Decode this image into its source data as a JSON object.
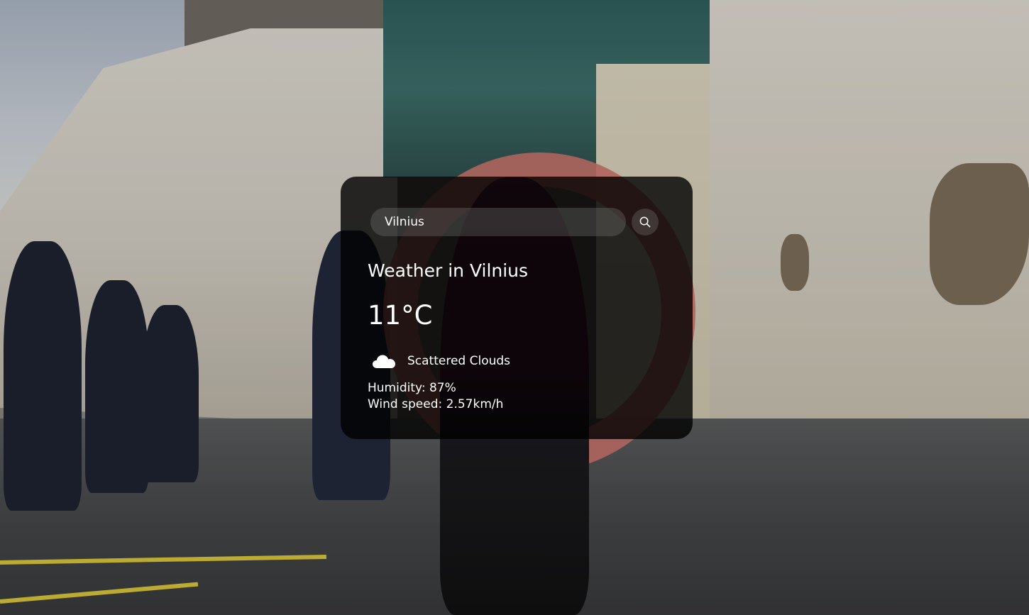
{
  "search": {
    "value": "Vilnius",
    "icon": "search-icon"
  },
  "weather": {
    "title": "Weather in Vilnius",
    "temperature": "11°C",
    "condition_icon": "cloud-icon",
    "condition": "Scattered Clouds",
    "humidity_label": "Humidity: ",
    "humidity_value": "87%",
    "wind_label": "Wind speed: ",
    "wind_value": "2.57km/h"
  },
  "colors": {
    "card_background": "rgba(0,0,0,0.80)",
    "input_background": "#7c7c7c",
    "text": "#ffffff"
  }
}
